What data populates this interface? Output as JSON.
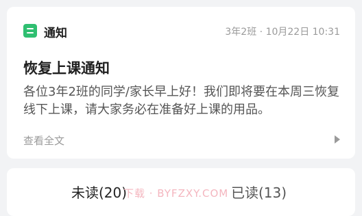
{
  "notification": {
    "app_icon": "notice-icon",
    "app_name": "通知",
    "class_name": "3年2班",
    "separator": "·",
    "datetime": "10月22日 10:31",
    "title": "恢复上课通知",
    "body": "各位3年2班的同学/家长早上好！我们即将要在本周三恢复线下上课，请大家务必在准备好上课的用品。",
    "view_all": "查看全文",
    "arrow_icon": "chevron-right-icon"
  },
  "read_status": {
    "unread_label": "未读(20)",
    "read_label": "已读(13)"
  },
  "watermark": "下载 · BYFZXY.COM",
  "colors": {
    "accent": "#2fbf71",
    "background": "#f2f3f5",
    "card": "#ffffff",
    "meta_text": "#9a9a9a"
  }
}
